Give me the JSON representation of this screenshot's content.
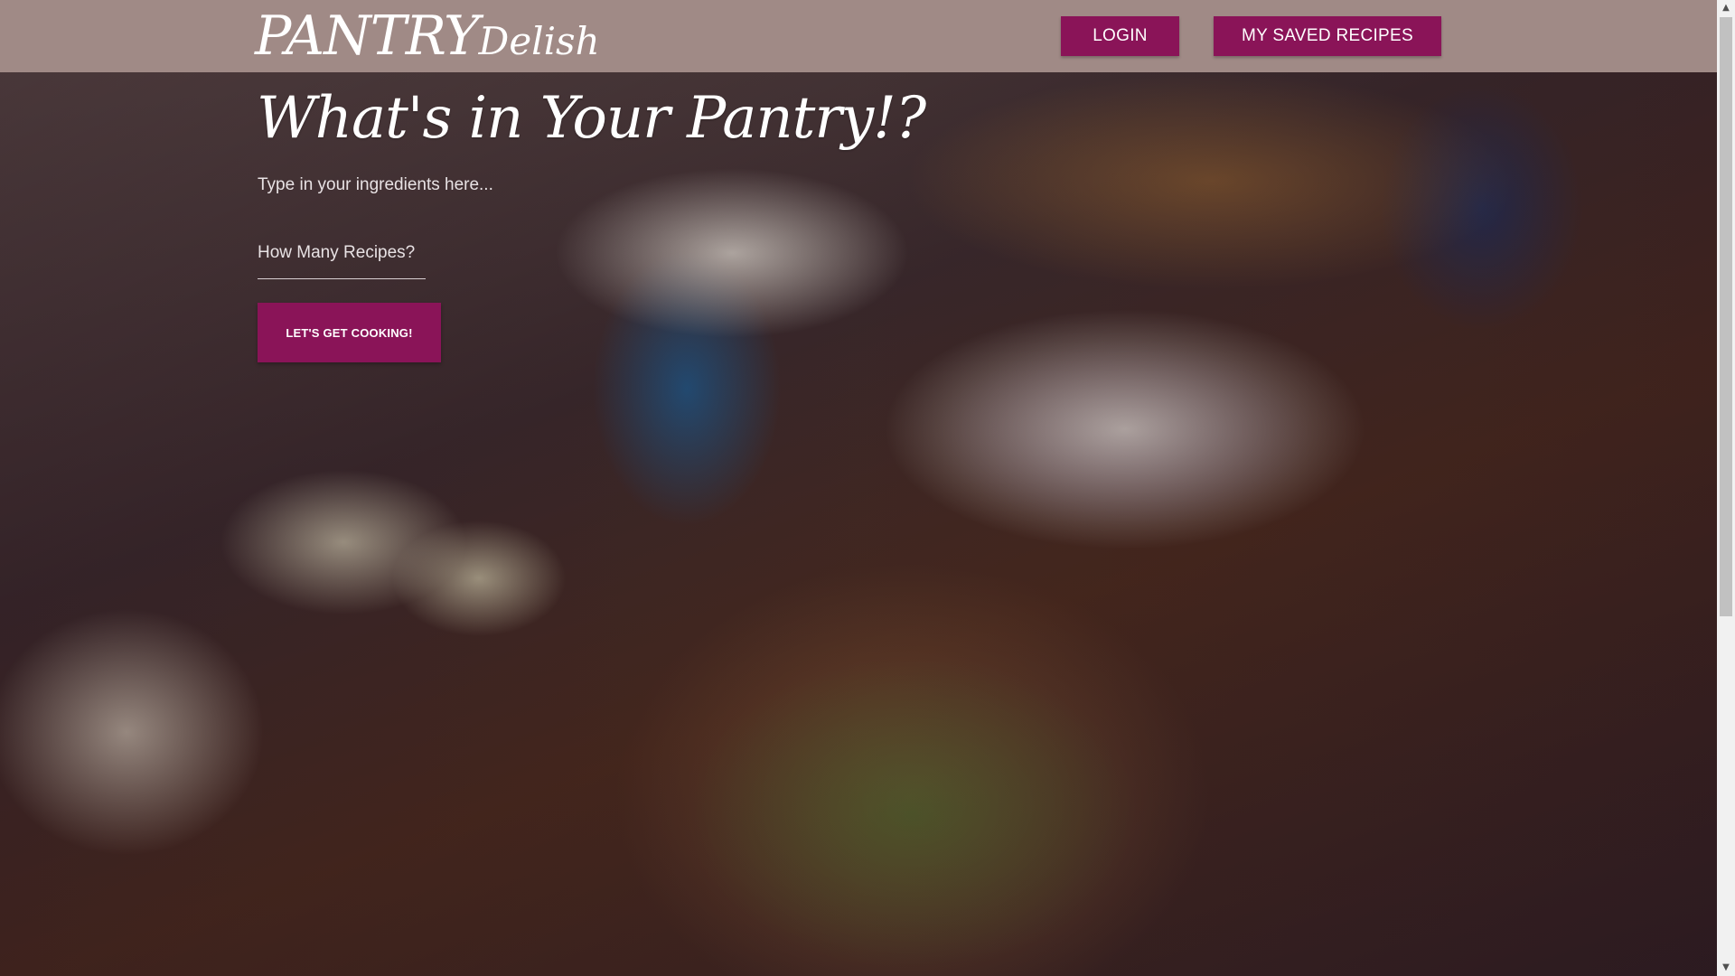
{
  "header": {
    "logo_main": "PANTRY",
    "logo_secondary": "Delish",
    "login_label": "LOGIN",
    "saved_recipes_label": "MY SAVED RECIPES"
  },
  "hero": {
    "headline": "What's in Your Pantry!?",
    "ingredients_placeholder": "Type in your ingredients here...",
    "recipe_count_placeholder": "How Many Recipes?",
    "cook_button_label": "LET'S GET COOKING!"
  },
  "scrollbar": {
    "up_arrow": "▲",
    "down_arrow": "▼"
  },
  "colors": {
    "header_bg": "#a08a86",
    "accent": "#8a1458",
    "text": "#ffffff"
  }
}
